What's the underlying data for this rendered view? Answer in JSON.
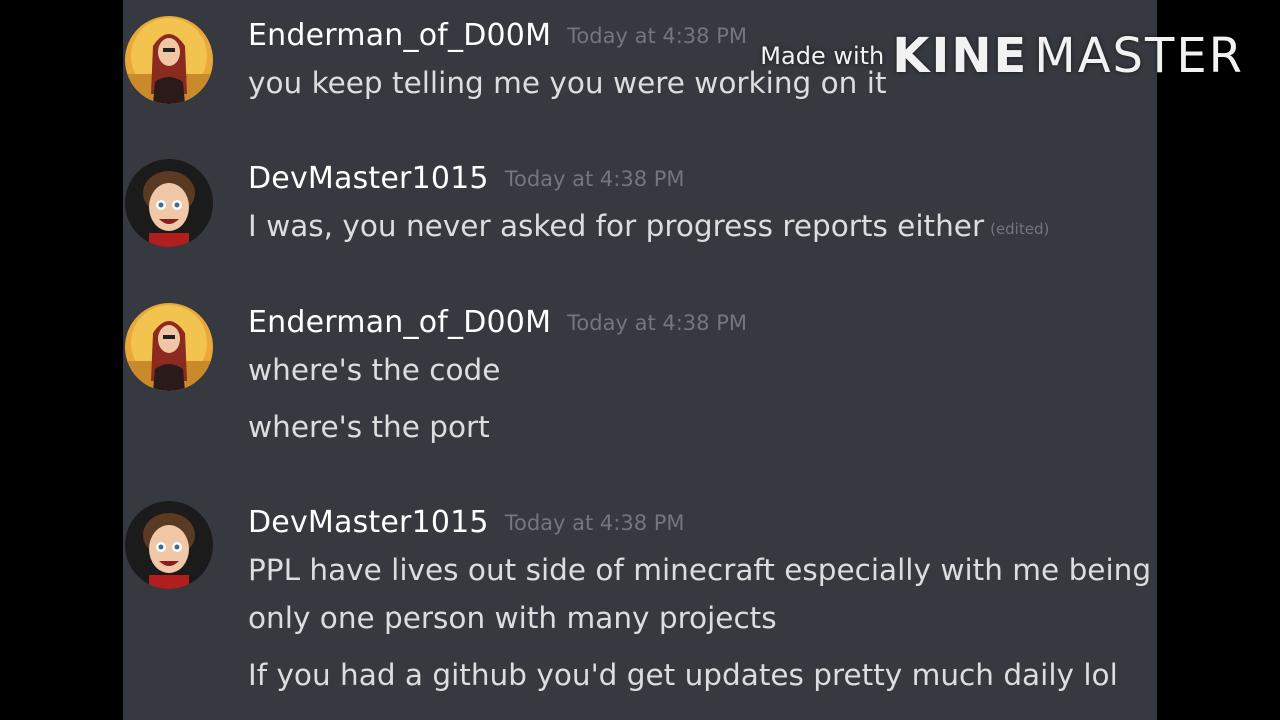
{
  "colors": {
    "background": "#36393f",
    "username": "#ffffff",
    "message_text": "#dcddde",
    "timestamp": "#72767d"
  },
  "watermark": {
    "made_with": "Made with",
    "kine": "KINE",
    "master": "MASTER"
  },
  "messages": [
    {
      "username": "Enderman_of_D00M",
      "timestamp": "Today at 4:38 PM",
      "avatar": "female-avatar-icon",
      "lines": [
        "you keep telling me you were working on it"
      ]
    },
    {
      "username": "DevMaster1015",
      "timestamp": "Today at 4:38 PM",
      "avatar": "male-avatar-icon",
      "lines": [
        "I was, you never asked for progress reports either"
      ],
      "edited": "(edited)"
    },
    {
      "username": "Enderman_of_D00M",
      "timestamp": "Today at 4:38 PM",
      "avatar": "female-avatar-icon",
      "lines": [
        "where's the code",
        "where's the port"
      ]
    },
    {
      "username": "DevMaster1015",
      "timestamp": "Today at 4:38 PM",
      "avatar": "male-avatar-icon",
      "lines": [
        "PPL have lives out side of minecraft especially with me being",
        "only one person with many projects",
        "If you had a github you'd get updates pretty much daily lol"
      ]
    }
  ]
}
